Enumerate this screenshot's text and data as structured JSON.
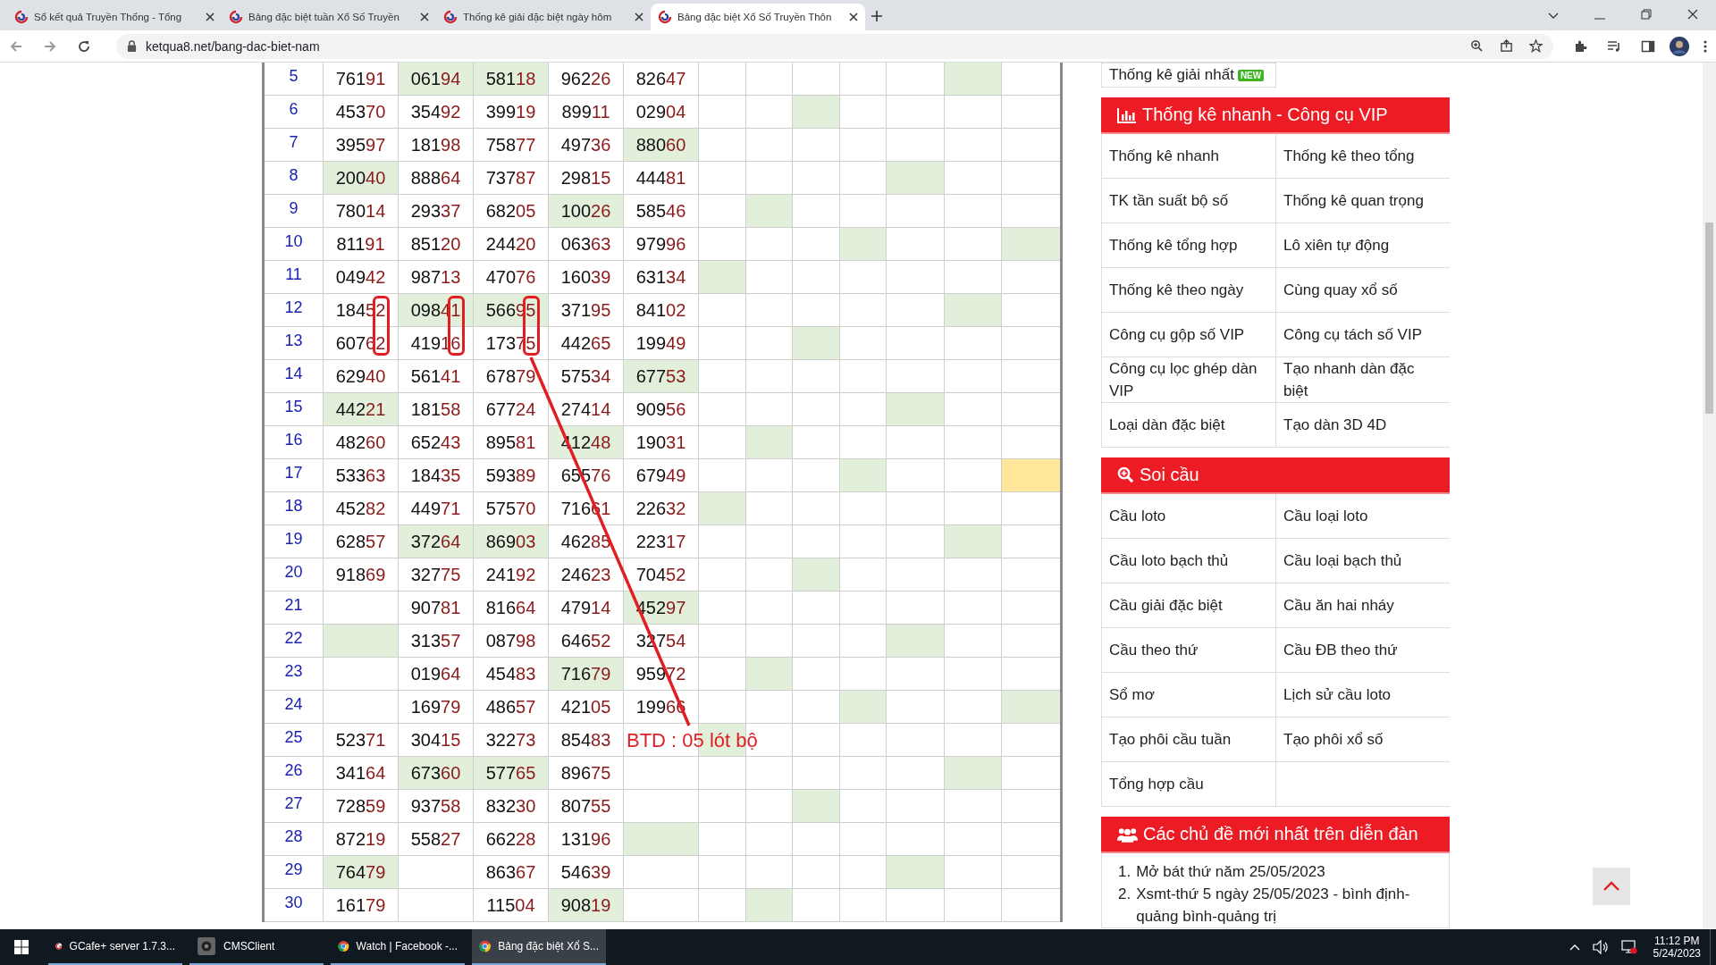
{
  "browser": {
    "tabs": [
      {
        "title": "Sổ kết quả Truyền Thống - Tổng",
        "selected": false
      },
      {
        "title": "Bảng đặc biệt tuần Xổ Số Truyền",
        "selected": false
      },
      {
        "title": "Thống kê giải đặc biệt ngày hôm",
        "selected": false
      },
      {
        "title": "Bảng đặc biệt Xổ Số Truyền Thôn",
        "selected": true
      }
    ],
    "url": "ketqua8.net/bang-dac-biet-nam"
  },
  "table": {
    "rows": [
      {
        "index": "5",
        "cells": [
          {
            "head": "761",
            "tail": "91",
            "highlighted": false
          },
          {
            "head": "061",
            "tail": "94",
            "highlighted": true
          },
          {
            "head": "581",
            "tail": "18",
            "highlighted": true
          },
          {
            "head": "962",
            "tail": "26",
            "highlighted": false
          },
          {
            "head": "826",
            "tail": "47",
            "highlighted": false
          }
        ],
        "marks": [
          {
            "highlighted": false
          },
          {
            "highlighted": false
          },
          {
            "highlighted": false
          },
          {
            "highlighted": false
          },
          {
            "highlighted": false
          },
          {
            "highlighted": true,
            "color": "#e2efda"
          },
          {
            "highlighted": false
          }
        ]
      },
      {
        "index": "6",
        "cells": [
          {
            "head": "453",
            "tail": "70",
            "highlighted": false
          },
          {
            "head": "354",
            "tail": "92",
            "highlighted": false
          },
          {
            "head": "399",
            "tail": "19",
            "highlighted": false
          },
          {
            "head": "899",
            "tail": "11",
            "highlighted": false
          },
          {
            "head": "029",
            "tail": "04",
            "highlighted": false
          }
        ],
        "marks": [
          {
            "highlighted": false
          },
          {
            "highlighted": false
          },
          {
            "highlighted": true,
            "color": "#e2efda"
          },
          {
            "highlighted": false
          },
          {
            "highlighted": false
          },
          {
            "highlighted": false
          },
          {
            "highlighted": false
          }
        ]
      },
      {
        "index": "7",
        "cells": [
          {
            "head": "395",
            "tail": "97",
            "highlighted": false
          },
          {
            "head": "181",
            "tail": "98",
            "highlighted": false
          },
          {
            "head": "758",
            "tail": "77",
            "highlighted": false
          },
          {
            "head": "497",
            "tail": "36",
            "highlighted": false
          },
          {
            "head": "880",
            "tail": "60",
            "highlighted": true
          }
        ],
        "marks": [
          {
            "highlighted": false
          },
          {
            "highlighted": false
          },
          {
            "highlighted": false
          },
          {
            "highlighted": false
          },
          {
            "highlighted": false
          },
          {
            "highlighted": false
          },
          {
            "highlighted": false
          }
        ]
      },
      {
        "index": "8",
        "cells": [
          {
            "head": "200",
            "tail": "40",
            "highlighted": true
          },
          {
            "head": "888",
            "tail": "64",
            "highlighted": false
          },
          {
            "head": "737",
            "tail": "87",
            "highlighted": false
          },
          {
            "head": "298",
            "tail": "15",
            "highlighted": false
          },
          {
            "head": "444",
            "tail": "81",
            "highlighted": false
          }
        ],
        "marks": [
          {
            "highlighted": false
          },
          {
            "highlighted": false
          },
          {
            "highlighted": false
          },
          {
            "highlighted": false
          },
          {
            "highlighted": true,
            "color": "#e2efda"
          },
          {
            "highlighted": false
          },
          {
            "highlighted": false
          }
        ]
      },
      {
        "index": "9",
        "cells": [
          {
            "head": "780",
            "tail": "14",
            "highlighted": false
          },
          {
            "head": "293",
            "tail": "37",
            "highlighted": false
          },
          {
            "head": "682",
            "tail": "05",
            "highlighted": false
          },
          {
            "head": "100",
            "tail": "26",
            "highlighted": true
          },
          {
            "head": "585",
            "tail": "46",
            "highlighted": false
          }
        ],
        "marks": [
          {
            "highlighted": false
          },
          {
            "highlighted": true,
            "color": "#e2efda"
          },
          {
            "highlighted": false
          },
          {
            "highlighted": false
          },
          {
            "highlighted": false
          },
          {
            "highlighted": false
          },
          {
            "highlighted": false
          }
        ]
      },
      {
        "index": "10",
        "cells": [
          {
            "head": "811",
            "tail": "91",
            "highlighted": false
          },
          {
            "head": "851",
            "tail": "20",
            "highlighted": false
          },
          {
            "head": "244",
            "tail": "20",
            "highlighted": false
          },
          {
            "head": "063",
            "tail": "63",
            "highlighted": false
          },
          {
            "head": "979",
            "tail": "96",
            "highlighted": false
          }
        ],
        "marks": [
          {
            "highlighted": false
          },
          {
            "highlighted": false
          },
          {
            "highlighted": false
          },
          {
            "highlighted": true,
            "color": "#e2efda"
          },
          {
            "highlighted": false
          },
          {
            "highlighted": false
          },
          {
            "highlighted": true,
            "color": "#e2efda"
          }
        ]
      },
      {
        "index": "11",
        "cells": [
          {
            "head": "049",
            "tail": "42",
            "highlighted": false
          },
          {
            "head": "987",
            "tail": "13",
            "highlighted": false
          },
          {
            "head": "470",
            "tail": "76",
            "highlighted": false
          },
          {
            "head": "160",
            "tail": "39",
            "highlighted": false
          },
          {
            "head": "631",
            "tail": "34",
            "highlighted": false
          }
        ],
        "marks": [
          {
            "highlighted": true,
            "color": "#e2efda"
          },
          {
            "highlighted": false
          },
          {
            "highlighted": false
          },
          {
            "highlighted": false
          },
          {
            "highlighted": false
          },
          {
            "highlighted": false
          },
          {
            "highlighted": false
          }
        ]
      },
      {
        "index": "12",
        "cells": [
          {
            "head": "184",
            "tail": "52",
            "highlighted": false
          },
          {
            "head": "098",
            "tail": "41",
            "highlighted": true
          },
          {
            "head": "566",
            "tail": "95",
            "highlighted": true
          },
          {
            "head": "371",
            "tail": "95",
            "highlighted": false
          },
          {
            "head": "841",
            "tail": "02",
            "highlighted": false
          }
        ],
        "marks": [
          {
            "highlighted": false
          },
          {
            "highlighted": false
          },
          {
            "highlighted": false
          },
          {
            "highlighted": false
          },
          {
            "highlighted": false
          },
          {
            "highlighted": true,
            "color": "#e2efda"
          },
          {
            "highlighted": false
          }
        ]
      },
      {
        "index": "13",
        "cells": [
          {
            "head": "607",
            "tail": "62",
            "highlighted": false
          },
          {
            "head": "419",
            "tail": "16",
            "highlighted": false
          },
          {
            "head": "173",
            "tail": "75",
            "highlighted": false
          },
          {
            "head": "442",
            "tail": "65",
            "highlighted": false
          },
          {
            "head": "199",
            "tail": "49",
            "highlighted": false
          }
        ],
        "marks": [
          {
            "highlighted": false
          },
          {
            "highlighted": false
          },
          {
            "highlighted": true,
            "color": "#e2efda"
          },
          {
            "highlighted": false
          },
          {
            "highlighted": false
          },
          {
            "highlighted": false
          },
          {
            "highlighted": false
          }
        ]
      },
      {
        "index": "14",
        "cells": [
          {
            "head": "629",
            "tail": "40",
            "highlighted": false
          },
          {
            "head": "561",
            "tail": "41",
            "highlighted": false
          },
          {
            "head": "678",
            "tail": "79",
            "highlighted": false
          },
          {
            "head": "575",
            "tail": "34",
            "highlighted": false
          },
          {
            "head": "677",
            "tail": "53",
            "highlighted": true
          }
        ],
        "marks": [
          {
            "highlighted": false
          },
          {
            "highlighted": false
          },
          {
            "highlighted": false
          },
          {
            "highlighted": false
          },
          {
            "highlighted": false
          },
          {
            "highlighted": false
          },
          {
            "highlighted": false
          }
        ]
      },
      {
        "index": "15",
        "cells": [
          {
            "head": "442",
            "tail": "21",
            "highlighted": true
          },
          {
            "head": "181",
            "tail": "58",
            "highlighted": false
          },
          {
            "head": "677",
            "tail": "24",
            "highlighted": false
          },
          {
            "head": "274",
            "tail": "14",
            "highlighted": false
          },
          {
            "head": "909",
            "tail": "56",
            "highlighted": false
          }
        ],
        "marks": [
          {
            "highlighted": false
          },
          {
            "highlighted": false
          },
          {
            "highlighted": false
          },
          {
            "highlighted": false
          },
          {
            "highlighted": true,
            "color": "#e2efda"
          },
          {
            "highlighted": false
          },
          {
            "highlighted": false
          }
        ]
      },
      {
        "index": "16",
        "cells": [
          {
            "head": "482",
            "tail": "60",
            "highlighted": false
          },
          {
            "head": "652",
            "tail": "43",
            "highlighted": false
          },
          {
            "head": "895",
            "tail": "81",
            "highlighted": false
          },
          {
            "head": "412",
            "tail": "48",
            "highlighted": true
          },
          {
            "head": "190",
            "tail": "31",
            "highlighted": false
          }
        ],
        "marks": [
          {
            "highlighted": false
          },
          {
            "highlighted": true,
            "color": "#e2efda"
          },
          {
            "highlighted": false
          },
          {
            "highlighted": false
          },
          {
            "highlighted": false
          },
          {
            "highlighted": false
          },
          {
            "highlighted": false
          }
        ]
      },
      {
        "index": "17",
        "cells": [
          {
            "head": "533",
            "tail": "63",
            "highlighted": false
          },
          {
            "head": "184",
            "tail": "35",
            "highlighted": false
          },
          {
            "head": "593",
            "tail": "89",
            "highlighted": false
          },
          {
            "head": "655",
            "tail": "76",
            "highlighted": false
          },
          {
            "head": "679",
            "tail": "49",
            "highlighted": false
          }
        ],
        "marks": [
          {
            "highlighted": false
          },
          {
            "highlighted": false
          },
          {
            "highlighted": false
          },
          {
            "highlighted": true,
            "color": "#e2efda"
          },
          {
            "highlighted": false
          },
          {
            "highlighted": false
          },
          {
            "highlighted": true,
            "color": "#ffe699"
          }
        ]
      },
      {
        "index": "18",
        "cells": [
          {
            "head": "452",
            "tail": "82",
            "highlighted": false
          },
          {
            "head": "449",
            "tail": "71",
            "highlighted": false
          },
          {
            "head": "575",
            "tail": "70",
            "highlighted": false
          },
          {
            "head": "716",
            "tail": "61",
            "highlighted": false
          },
          {
            "head": "226",
            "tail": "32",
            "highlighted": false
          }
        ],
        "marks": [
          {
            "highlighted": true,
            "color": "#e2efda"
          },
          {
            "highlighted": false
          },
          {
            "highlighted": false
          },
          {
            "highlighted": false
          },
          {
            "highlighted": false
          },
          {
            "highlighted": false
          },
          {
            "highlighted": false
          }
        ]
      },
      {
        "index": "19",
        "cells": [
          {
            "head": "628",
            "tail": "57",
            "highlighted": false
          },
          {
            "head": "372",
            "tail": "64",
            "highlighted": true
          },
          {
            "head": "869",
            "tail": "03",
            "highlighted": true
          },
          {
            "head": "462",
            "tail": "85",
            "highlighted": false
          },
          {
            "head": "223",
            "tail": "17",
            "highlighted": false
          }
        ],
        "marks": [
          {
            "highlighted": false
          },
          {
            "highlighted": false
          },
          {
            "highlighted": false
          },
          {
            "highlighted": false
          },
          {
            "highlighted": false
          },
          {
            "highlighted": true,
            "color": "#e2efda"
          },
          {
            "highlighted": false
          }
        ]
      },
      {
        "index": "20",
        "cells": [
          {
            "head": "918",
            "tail": "69",
            "highlighted": false
          },
          {
            "head": "327",
            "tail": "75",
            "highlighted": false
          },
          {
            "head": "241",
            "tail": "92",
            "highlighted": false
          },
          {
            "head": "246",
            "tail": "23",
            "highlighted": false
          },
          {
            "head": "704",
            "tail": "52",
            "highlighted": false
          }
        ],
        "marks": [
          {
            "highlighted": false
          },
          {
            "highlighted": false
          },
          {
            "highlighted": true,
            "color": "#e2efda"
          },
          {
            "highlighted": false
          },
          {
            "highlighted": false
          },
          {
            "highlighted": false
          },
          {
            "highlighted": false
          }
        ]
      },
      {
        "index": "21",
        "cells": [
          {
            "highlighted": false
          },
          {
            "head": "907",
            "tail": "81",
            "highlighted": false
          },
          {
            "head": "816",
            "tail": "64",
            "highlighted": false
          },
          {
            "head": "479",
            "tail": "14",
            "highlighted": false
          },
          {
            "head": "452",
            "tail": "97",
            "highlighted": true
          }
        ],
        "marks": [
          {
            "highlighted": false
          },
          {
            "highlighted": false
          },
          {
            "highlighted": false
          },
          {
            "highlighted": false
          },
          {
            "highlighted": false
          },
          {
            "highlighted": false
          },
          {
            "highlighted": false
          }
        ]
      },
      {
        "index": "22",
        "cells": [
          {
            "highlighted": true
          },
          {
            "head": "313",
            "tail": "57",
            "highlighted": false
          },
          {
            "head": "087",
            "tail": "98",
            "highlighted": false
          },
          {
            "head": "646",
            "tail": "52",
            "highlighted": false
          },
          {
            "head": "327",
            "tail": "54",
            "highlighted": false
          }
        ],
        "marks": [
          {
            "highlighted": false
          },
          {
            "highlighted": false
          },
          {
            "highlighted": false
          },
          {
            "highlighted": false
          },
          {
            "highlighted": true,
            "color": "#e2efda"
          },
          {
            "highlighted": false
          },
          {
            "highlighted": false
          }
        ]
      },
      {
        "index": "23",
        "cells": [
          {
            "highlighted": false
          },
          {
            "head": "019",
            "tail": "64",
            "highlighted": false
          },
          {
            "head": "454",
            "tail": "83",
            "highlighted": false
          },
          {
            "head": "716",
            "tail": "79",
            "highlighted": true
          },
          {
            "head": "959",
            "tail": "72",
            "highlighted": false
          }
        ],
        "marks": [
          {
            "highlighted": false
          },
          {
            "highlighted": true,
            "color": "#e2efda"
          },
          {
            "highlighted": false
          },
          {
            "highlighted": false
          },
          {
            "highlighted": false
          },
          {
            "highlighted": false
          },
          {
            "highlighted": false
          }
        ]
      },
      {
        "index": "24",
        "cells": [
          {
            "highlighted": false
          },
          {
            "head": "169",
            "tail": "79",
            "highlighted": false
          },
          {
            "head": "486",
            "tail": "57",
            "highlighted": false
          },
          {
            "head": "421",
            "tail": "05",
            "highlighted": false
          },
          {
            "head": "199",
            "tail": "66",
            "highlighted": false
          }
        ],
        "marks": [
          {
            "highlighted": false
          },
          {
            "highlighted": false
          },
          {
            "highlighted": false
          },
          {
            "highlighted": true,
            "color": "#e2efda"
          },
          {
            "highlighted": false
          },
          {
            "highlighted": false
          },
          {
            "highlighted": true,
            "color": "#e2efda"
          }
        ]
      },
      {
        "index": "25",
        "cells": [
          {
            "head": "523",
            "tail": "71",
            "highlighted": false
          },
          {
            "head": "304",
            "tail": "15",
            "highlighted": false
          },
          {
            "head": "322",
            "tail": "73",
            "highlighted": false
          },
          {
            "head": "854",
            "tail": "83",
            "highlighted": false
          },
          {
            "highlighted": false
          }
        ],
        "marks": [
          {
            "highlighted": true,
            "color": "#e2efda"
          },
          {
            "highlighted": false
          },
          {
            "highlighted": false
          },
          {
            "highlighted": false
          },
          {
            "highlighted": false
          },
          {
            "highlighted": false
          },
          {
            "highlighted": false
          }
        ]
      },
      {
        "index": "26",
        "cells": [
          {
            "head": "341",
            "tail": "64",
            "highlighted": false
          },
          {
            "head": "673",
            "tail": "60",
            "highlighted": true
          },
          {
            "head": "577",
            "tail": "65",
            "highlighted": true
          },
          {
            "head": "896",
            "tail": "75",
            "highlighted": false
          },
          {
            "highlighted": false
          }
        ],
        "marks": [
          {
            "highlighted": false
          },
          {
            "highlighted": false
          },
          {
            "highlighted": false
          },
          {
            "highlighted": false
          },
          {
            "highlighted": false
          },
          {
            "highlighted": true,
            "color": "#e2efda"
          },
          {
            "highlighted": false
          }
        ]
      },
      {
        "index": "27",
        "cells": [
          {
            "head": "728",
            "tail": "59",
            "highlighted": false
          },
          {
            "head": "937",
            "tail": "58",
            "highlighted": false
          },
          {
            "head": "832",
            "tail": "30",
            "highlighted": false
          },
          {
            "head": "807",
            "tail": "55",
            "highlighted": false
          },
          {
            "highlighted": false
          }
        ],
        "marks": [
          {
            "highlighted": false
          },
          {
            "highlighted": false
          },
          {
            "highlighted": true,
            "color": "#e2efda"
          },
          {
            "highlighted": false
          },
          {
            "highlighted": false
          },
          {
            "highlighted": false
          },
          {
            "highlighted": false
          }
        ]
      },
      {
        "index": "28",
        "cells": [
          {
            "head": "872",
            "tail": "19",
            "highlighted": false
          },
          {
            "head": "558",
            "tail": "27",
            "highlighted": false
          },
          {
            "head": "662",
            "tail": "28",
            "highlighted": false
          },
          {
            "head": "131",
            "tail": "96",
            "highlighted": false
          },
          {
            "highlighted": true
          }
        ],
        "marks": [
          {
            "highlighted": false
          },
          {
            "highlighted": false
          },
          {
            "highlighted": false
          },
          {
            "highlighted": false
          },
          {
            "highlighted": false
          },
          {
            "highlighted": false
          },
          {
            "highlighted": false
          }
        ]
      },
      {
        "index": "29",
        "cells": [
          {
            "head": "764",
            "tail": "79",
            "highlighted": true
          },
          {
            "highlighted": false
          },
          {
            "head": "863",
            "tail": "67",
            "highlighted": false
          },
          {
            "head": "546",
            "tail": "39",
            "highlighted": false
          },
          {
            "highlighted": false
          }
        ],
        "marks": [
          {
            "highlighted": false
          },
          {
            "highlighted": false
          },
          {
            "highlighted": false
          },
          {
            "highlighted": false
          },
          {
            "highlighted": true,
            "color": "#e2efda"
          },
          {
            "highlighted": false
          },
          {
            "highlighted": false
          }
        ]
      },
      {
        "index": "30",
        "cells": [
          {
            "head": "161",
            "tail": "79",
            "highlighted": false
          },
          {
            "highlighted": false
          },
          {
            "head": "115",
            "tail": "04",
            "highlighted": false
          },
          {
            "head": "908",
            "tail": "19",
            "highlighted": true
          },
          {
            "highlighted": false
          }
        ],
        "marks": [
          {
            "highlighted": false
          },
          {
            "highlighted": true,
            "color": "#e2efda"
          },
          {
            "highlighted": false
          },
          {
            "highlighted": false
          },
          {
            "highlighted": false
          },
          {
            "highlighted": false
          },
          {
            "highlighted": false
          }
        ]
      }
    ]
  },
  "annotation": {
    "label": "BTD : 05 lót bộ"
  },
  "sidebar": {
    "top_item": {
      "label": "Thống kê giải nhất",
      "badge": "NEW"
    },
    "sections": [
      {
        "title": "Thống kê nhanh - Công cụ VIP",
        "kind": "chart",
        "items": [
          "Thống kê nhanh",
          "Thống kê theo tổng",
          "TK tần suất bộ số",
          "Thống kê quan trọng",
          "Thống kê tổng hợp",
          "Lô xiên tự động",
          "Thống kê theo ngày",
          "Cùng quay xổ số",
          "Công cụ gộp số VIP",
          "Công cụ tách số VIP",
          "Công cụ lọc ghép dàn VIP",
          "Tạo nhanh dàn đặc biệt",
          "Loại dàn đặc biệt",
          "Tạo dàn 3D 4D"
        ]
      },
      {
        "title": "Soi cầu",
        "kind": "search",
        "items": [
          "Cầu loto",
          "Cầu loại loto",
          "Cầu loto bạch thủ",
          "Cầu loại bạch thủ",
          "Cầu giải đặc biệt",
          "Cầu ăn hai nháy",
          "Cầu theo thứ",
          "Cầu ĐB theo thứ",
          "Sổ mơ",
          "Lịch sử cầu loto",
          "Tạo phôi cầu tuần",
          "Tạo phôi xổ số",
          "Tổng hợp cầu"
        ]
      }
    ],
    "forum": {
      "title": "Các chủ đề mới nhất trên diễn đàn",
      "kind": "people",
      "topics": [
        {
          "number": "1.",
          "title": "Mở bát thứ năm 25/05/2023"
        },
        {
          "number": "2.",
          "title": "Xsmt-thứ 5 ngày 25/05/2023 - bình định-quảng bình-quảng trị"
        }
      ]
    }
  },
  "taskbar": {
    "apps": [
      {
        "label": "GCafe+ server 1.7.3...",
        "kind": "gcafe",
        "selected": false
      },
      {
        "label": "CMSClient",
        "kind": "camera",
        "selected": false
      },
      {
        "label": "Watch | Facebook -...",
        "kind": "chrome",
        "selected": false
      },
      {
        "label": "Bảng đặc biệt Xổ S...",
        "kind": "chrome",
        "selected": true
      }
    ],
    "time": "11:12 PM",
    "date": "5/24/2023"
  }
}
